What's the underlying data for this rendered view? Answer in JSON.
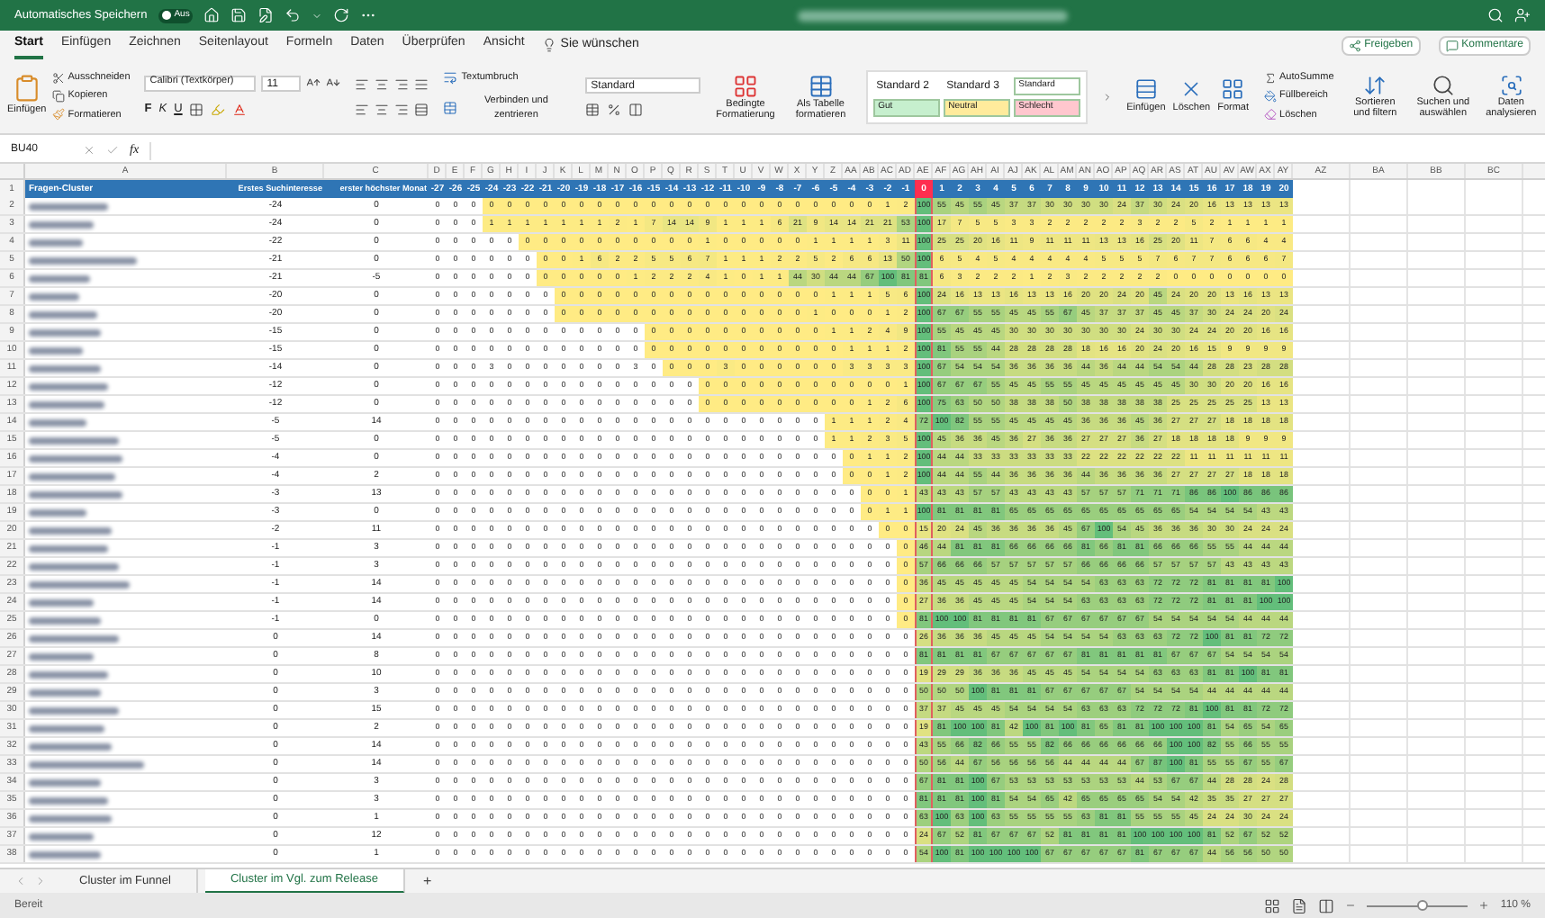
{
  "title_bar": {
    "autosave_label": "Automatisches Speichern",
    "autosave": {
      "on": false,
      "label": "Aus"
    }
  },
  "menu_tabs": [
    {
      "label": "Start",
      "selected": true
    },
    {
      "label": "Einfügen",
      "selected": false
    },
    {
      "label": "Zeichnen",
      "selected": false
    },
    {
      "label": "Seitenlayout",
      "selected": false
    },
    {
      "label": "Formeln",
      "selected": false
    },
    {
      "label": "Daten",
      "selected": false
    },
    {
      "label": "Überprüfen",
      "selected": false
    },
    {
      "label": "Ansicht",
      "selected": false
    }
  ],
  "tell_me": "Sie wünschen",
  "share": "Freigeben",
  "comments": "Kommentare",
  "clipboard": {
    "paste": "Einfügen",
    "cut": "Ausschneiden",
    "copy": "Kopieren",
    "format": "Formatieren"
  },
  "font": {
    "name": "Calibri (Textkörper)",
    "size": "11",
    "bold": "F",
    "italic": "K",
    "underline": "U"
  },
  "alignment": {
    "wrap": "Textumbruch",
    "merge": "Verbinden und zentrieren"
  },
  "number_format": "Standard",
  "conditional": "Bedingte Formatierung",
  "as_table": "Als Tabelle formatieren",
  "styles": [
    {
      "label": "Standard 2",
      "color": "#ffffff"
    },
    {
      "label": "Standard 3",
      "color": "#ffffff"
    },
    {
      "label": "Standard",
      "color": "#ffffff"
    },
    {
      "label": "Gut",
      "color": "#c6efce"
    },
    {
      "label": "Neutral",
      "color": "#ffeb9c"
    },
    {
      "label": "Schlecht",
      "color": "#ffc7ce"
    }
  ],
  "cells_group": [
    "Einfügen",
    "Löschen",
    "Format"
  ],
  "editing": {
    "autosum": "AutoSumme",
    "fill": "Füllbereich",
    "clear": "Löschen",
    "sort": "Sortieren und filtern",
    "find": "Suchen und auswählen",
    "analyze": "Daten analysieren"
  },
  "formula_bar": {
    "name_box": "BU40",
    "fx": "fx"
  },
  "column_letters": [
    "A",
    "B",
    "C",
    "D",
    "E",
    "F",
    "G",
    "H",
    "I",
    "J",
    "K",
    "L",
    "M",
    "N",
    "O",
    "P",
    "Q",
    "R",
    "S",
    "T",
    "U",
    "V",
    "W",
    "X",
    "Y",
    "Z",
    "AA",
    "AB",
    "AC",
    "AD",
    "AE",
    "AF",
    "AG",
    "AH",
    "AI",
    "AJ",
    "AK",
    "AL",
    "AM",
    "AN",
    "AO",
    "AP",
    "AQ",
    "AR",
    "AS",
    "AT",
    "AU",
    "AV",
    "AW",
    "AX",
    "AY",
    "AZ",
    "BA",
    "BB",
    "BC"
  ],
  "header_row": {
    "number": "1",
    "a": "Fragen-Cluster",
    "b": "Erstes Suchinteresse",
    "c": "erster höchster Monat",
    "cells": [
      "-27",
      "-26",
      "-25",
      "-24",
      "-23",
      "-22",
      "-21",
      "-20",
      "-19",
      "-18",
      "-17",
      "-16",
      "-15",
      "-14",
      "-13",
      "-12",
      "-11",
      "-10",
      "-9",
      "-8",
      "-7",
      "-6",
      "-5",
      "-4",
      "-3",
      "-2",
      "-1",
      "0",
      "1",
      "2",
      "3",
      "4",
      "5",
      "6",
      "7",
      "8",
      "9",
      "10",
      "11",
      "12",
      "13",
      "14",
      "15",
      "16",
      "17",
      "18",
      "19",
      "20"
    ]
  },
  "rows": [
    {
      "number": "2",
      "b": "-24",
      "c": "0",
      "cells": [
        "0",
        "0",
        "0",
        "0",
        "0",
        "0",
        "0",
        "0",
        "0",
        "0",
        "0",
        "0",
        "0",
        "0",
        "0",
        "0",
        "0",
        "0",
        "0",
        "0",
        "0",
        "0",
        "0",
        "0",
        "0",
        "1",
        "2",
        "100",
        "55",
        "45",
        "55",
        "45",
        "37",
        "37",
        "30",
        "30",
        "30",
        "30",
        "24",
        "37",
        "30",
        "24",
        "20",
        "16",
        "13",
        "13",
        "13",
        "13"
      ]
    },
    {
      "number": "3",
      "b": "-24",
      "c": "0",
      "cells": [
        "0",
        "0",
        "0",
        "1",
        "1",
        "1",
        "1",
        "1",
        "1",
        "1",
        "2",
        "1",
        "7",
        "14",
        "14",
        "9",
        "1",
        "1",
        "1",
        "6",
        "21",
        "9",
        "14",
        "14",
        "21",
        "21",
        "53",
        "100",
        "17",
        "7",
        "5",
        "5",
        "3",
        "3",
        "2",
        "2",
        "2",
        "2",
        "2",
        "3",
        "2",
        "2",
        "5",
        "2",
        "1",
        "1",
        "1",
        "1"
      ]
    },
    {
      "number": "4",
      "b": "-22",
      "c": "0",
      "cells": [
        "0",
        "0",
        "0",
        "0",
        "0",
        "0",
        "0",
        "0",
        "0",
        "0",
        "0",
        "0",
        "0",
        "0",
        "0",
        "1",
        "0",
        "0",
        "0",
        "0",
        "0",
        "1",
        "1",
        "1",
        "1",
        "3",
        "11",
        "100",
        "25",
        "25",
        "20",
        "16",
        "11",
        "9",
        "11",
        "11",
        "11",
        "13",
        "13",
        "16",
        "25",
        "20",
        "11",
        "7",
        "6",
        "6",
        "4",
        "4"
      ]
    },
    {
      "number": "5",
      "b": "-21",
      "c": "0",
      "cells": [
        "0",
        "0",
        "0",
        "0",
        "0",
        "0",
        "0",
        "0",
        "1",
        "6",
        "2",
        "2",
        "5",
        "5",
        "6",
        "7",
        "1",
        "1",
        "1",
        "2",
        "2",
        "5",
        "2",
        "6",
        "6",
        "13",
        "50",
        "100",
        "6",
        "5",
        "4",
        "5",
        "4",
        "4",
        "4",
        "4",
        "4",
        "5",
        "5",
        "5",
        "7",
        "6",
        "7",
        "7",
        "6",
        "6",
        "6",
        "7"
      ]
    },
    {
      "number": "6",
      "b": "-21",
      "c": "-5",
      "cells": [
        "0",
        "0",
        "0",
        "0",
        "0",
        "0",
        "0",
        "0",
        "0",
        "0",
        "0",
        "1",
        "2",
        "2",
        "2",
        "4",
        "1",
        "0",
        "1",
        "1",
        "44",
        "30",
        "44",
        "44",
        "67",
        "100",
        "81",
        "81",
        "6",
        "3",
        "2",
        "2",
        "2",
        "1",
        "2",
        "3",
        "2",
        "2",
        "2",
        "2",
        "2",
        "0",
        "0",
        "0",
        "0",
        "0",
        "0",
        "0"
      ]
    },
    {
      "number": "7",
      "b": "-20",
      "c": "0",
      "cells": [
        "0",
        "0",
        "0",
        "0",
        "0",
        "0",
        "0",
        "0",
        "0",
        "0",
        "0",
        "0",
        "0",
        "0",
        "0",
        "0",
        "0",
        "0",
        "0",
        "0",
        "0",
        "0",
        "1",
        "1",
        "1",
        "5",
        "6",
        "100",
        "24",
        "16",
        "13",
        "13",
        "16",
        "13",
        "13",
        "16",
        "20",
        "20",
        "24",
        "20",
        "45",
        "24",
        "20",
        "20",
        "13",
        "16",
        "13",
        "13"
      ]
    },
    {
      "number": "8",
      "b": "-20",
      "c": "0",
      "cells": [
        "0",
        "0",
        "0",
        "0",
        "0",
        "0",
        "0",
        "0",
        "0",
        "0",
        "0",
        "0",
        "0",
        "0",
        "0",
        "0",
        "0",
        "0",
        "0",
        "0",
        "0",
        "1",
        "0",
        "0",
        "0",
        "1",
        "2",
        "100",
        "67",
        "67",
        "55",
        "55",
        "45",
        "45",
        "55",
        "67",
        "45",
        "37",
        "37",
        "37",
        "45",
        "45",
        "37",
        "30",
        "24",
        "24",
        "20",
        "24"
      ]
    },
    {
      "number": "9",
      "b": "-15",
      "c": "0",
      "cells": [
        "0",
        "0",
        "0",
        "0",
        "0",
        "0",
        "0",
        "0",
        "0",
        "0",
        "0",
        "0",
        "0",
        "0",
        "0",
        "0",
        "0",
        "0",
        "0",
        "0",
        "0",
        "0",
        "1",
        "1",
        "2",
        "4",
        "9",
        "100",
        "55",
        "45",
        "45",
        "45",
        "30",
        "30",
        "30",
        "30",
        "30",
        "30",
        "30",
        "24",
        "30",
        "30",
        "24",
        "24",
        "20",
        "20",
        "16",
        "16"
      ]
    },
    {
      "number": "10",
      "b": "-15",
      "c": "0",
      "cells": [
        "0",
        "0",
        "0",
        "0",
        "0",
        "0",
        "0",
        "0",
        "0",
        "0",
        "0",
        "0",
        "0",
        "0",
        "0",
        "0",
        "0",
        "0",
        "0",
        "0",
        "0",
        "0",
        "0",
        "1",
        "1",
        "1",
        "2",
        "100",
        "81",
        "55",
        "55",
        "44",
        "28",
        "28",
        "28",
        "28",
        "18",
        "16",
        "16",
        "20",
        "24",
        "20",
        "16",
        "15",
        "9",
        "9",
        "9",
        "9"
      ]
    },
    {
      "number": "11",
      "b": "-14",
      "c": "0",
      "cells": [
        "0",
        "0",
        "0",
        "3",
        "0",
        "0",
        "0",
        "0",
        "0",
        "0",
        "0",
        "3",
        "0",
        "0",
        "0",
        "0",
        "3",
        "0",
        "0",
        "0",
        "0",
        "0",
        "0",
        "3",
        "3",
        "3",
        "3",
        "100",
        "67",
        "54",
        "54",
        "54",
        "36",
        "36",
        "36",
        "36",
        "44",
        "36",
        "44",
        "44",
        "54",
        "54",
        "44",
        "28",
        "28",
        "23",
        "28",
        "28"
      ]
    },
    {
      "number": "12",
      "b": "-12",
      "c": "0",
      "cells": [
        "0",
        "0",
        "0",
        "0",
        "0",
        "0",
        "0",
        "0",
        "0",
        "0",
        "0",
        "0",
        "0",
        "0",
        "0",
        "0",
        "0",
        "0",
        "0",
        "0",
        "0",
        "0",
        "0",
        "0",
        "0",
        "0",
        "1",
        "100",
        "67",
        "67",
        "67",
        "55",
        "45",
        "45",
        "55",
        "55",
        "45",
        "45",
        "45",
        "45",
        "45",
        "45",
        "30",
        "30",
        "20",
        "20",
        "16",
        "16"
      ]
    },
    {
      "number": "13",
      "b": "-12",
      "c": "0",
      "cells": [
        "0",
        "0",
        "0",
        "0",
        "0",
        "0",
        "0",
        "0",
        "0",
        "0",
        "0",
        "0",
        "0",
        "0",
        "0",
        "0",
        "0",
        "0",
        "0",
        "0",
        "0",
        "0",
        "0",
        "0",
        "1",
        "2",
        "6",
        "100",
        "75",
        "63",
        "50",
        "50",
        "38",
        "38",
        "38",
        "50",
        "38",
        "38",
        "38",
        "38",
        "38",
        "25",
        "25",
        "25",
        "25",
        "25",
        "13",
        "13"
      ]
    },
    {
      "number": "14",
      "b": "-5",
      "c": "14",
      "cells": [
        "0",
        "0",
        "0",
        "0",
        "0",
        "0",
        "0",
        "0",
        "0",
        "0",
        "0",
        "0",
        "0",
        "0",
        "0",
        "0",
        "0",
        "0",
        "0",
        "0",
        "0",
        "0",
        "1",
        "1",
        "1",
        "2",
        "4",
        "72",
        "100",
        "82",
        "55",
        "55",
        "45",
        "45",
        "45",
        "45",
        "36",
        "36",
        "36",
        "45",
        "36",
        "27",
        "27",
        "27",
        "18",
        "18",
        "18",
        "18"
      ]
    },
    {
      "number": "15",
      "b": "-5",
      "c": "0",
      "cells": [
        "0",
        "0",
        "0",
        "0",
        "0",
        "0",
        "0",
        "0",
        "0",
        "0",
        "0",
        "0",
        "0",
        "0",
        "0",
        "0",
        "0",
        "0",
        "0",
        "0",
        "0",
        "0",
        "1",
        "1",
        "2",
        "3",
        "5",
        "100",
        "45",
        "36",
        "36",
        "45",
        "36",
        "27",
        "36",
        "36",
        "27",
        "27",
        "27",
        "36",
        "27",
        "18",
        "18",
        "18",
        "18",
        "9",
        "9",
        "9"
      ]
    },
    {
      "number": "16",
      "b": "-4",
      "c": "0",
      "cells": [
        "0",
        "0",
        "0",
        "0",
        "0",
        "0",
        "0",
        "0",
        "0",
        "0",
        "0",
        "0",
        "0",
        "0",
        "0",
        "0",
        "0",
        "0",
        "0",
        "0",
        "0",
        "0",
        "0",
        "0",
        "1",
        "1",
        "2",
        "100",
        "44",
        "44",
        "33",
        "33",
        "33",
        "33",
        "33",
        "33",
        "22",
        "22",
        "22",
        "22",
        "22",
        "22",
        "11",
        "11",
        "11",
        "11",
        "11",
        "11"
      ]
    },
    {
      "number": "17",
      "b": "-4",
      "c": "2",
      "cells": [
        "0",
        "0",
        "0",
        "0",
        "0",
        "0",
        "0",
        "0",
        "0",
        "0",
        "0",
        "0",
        "0",
        "0",
        "0",
        "0",
        "0",
        "0",
        "0",
        "0",
        "0",
        "0",
        "0",
        "0",
        "0",
        "1",
        "2",
        "100",
        "44",
        "44",
        "55",
        "44",
        "36",
        "36",
        "36",
        "36",
        "44",
        "36",
        "36",
        "36",
        "36",
        "27",
        "27",
        "27",
        "27",
        "18",
        "18",
        "18"
      ]
    },
    {
      "number": "18",
      "b": "-3",
      "c": "13",
      "cells": [
        "0",
        "0",
        "0",
        "0",
        "0",
        "0",
        "0",
        "0",
        "0",
        "0",
        "0",
        "0",
        "0",
        "0",
        "0",
        "0",
        "0",
        "0",
        "0",
        "0",
        "0",
        "0",
        "0",
        "0",
        "0",
        "0",
        "1",
        "43",
        "43",
        "43",
        "57",
        "57",
        "43",
        "43",
        "43",
        "43",
        "57",
        "57",
        "57",
        "71",
        "71",
        "71",
        "86",
        "86",
        "100",
        "86",
        "86",
        "86"
      ]
    },
    {
      "number": "19",
      "b": "-3",
      "c": "0",
      "cells": [
        "0",
        "0",
        "0",
        "0",
        "0",
        "0",
        "0",
        "0",
        "0",
        "0",
        "0",
        "0",
        "0",
        "0",
        "0",
        "0",
        "0",
        "0",
        "0",
        "0",
        "0",
        "0",
        "0",
        "0",
        "0",
        "1",
        "1",
        "100",
        "81",
        "81",
        "81",
        "81",
        "65",
        "65",
        "65",
        "65",
        "65",
        "65",
        "65",
        "65",
        "65",
        "65",
        "54",
        "54",
        "54",
        "54",
        "43",
        "43"
      ]
    },
    {
      "number": "20",
      "b": "-2",
      "c": "11",
      "cells": [
        "0",
        "0",
        "0",
        "0",
        "0",
        "0",
        "0",
        "0",
        "0",
        "0",
        "0",
        "0",
        "0",
        "0",
        "0",
        "0",
        "0",
        "0",
        "0",
        "0",
        "0",
        "0",
        "0",
        "0",
        "0",
        "0",
        "0",
        "15",
        "20",
        "24",
        "45",
        "36",
        "36",
        "36",
        "36",
        "45",
        "67",
        "100",
        "54",
        "45",
        "36",
        "36",
        "36",
        "30",
        "30",
        "24",
        "24",
        "24"
      ]
    },
    {
      "number": "21",
      "b": "-1",
      "c": "3",
      "cells": [
        "0",
        "0",
        "0",
        "0",
        "0",
        "0",
        "0",
        "0",
        "0",
        "0",
        "0",
        "0",
        "0",
        "0",
        "0",
        "0",
        "0",
        "0",
        "0",
        "0",
        "0",
        "0",
        "0",
        "0",
        "0",
        "0",
        "0",
        "46",
        "44",
        "81",
        "81",
        "81",
        "66",
        "66",
        "66",
        "66",
        "81",
        "66",
        "81",
        "81",
        "66",
        "66",
        "66",
        "55",
        "55",
        "44",
        "44",
        "44"
      ]
    },
    {
      "number": "22",
      "b": "-1",
      "c": "3",
      "cells": [
        "0",
        "0",
        "0",
        "0",
        "0",
        "0",
        "0",
        "0",
        "0",
        "0",
        "0",
        "0",
        "0",
        "0",
        "0",
        "0",
        "0",
        "0",
        "0",
        "0",
        "0",
        "0",
        "0",
        "0",
        "0",
        "0",
        "0",
        "57",
        "66",
        "66",
        "66",
        "57",
        "57",
        "57",
        "57",
        "57",
        "66",
        "66",
        "66",
        "66",
        "57",
        "57",
        "57",
        "57",
        "43",
        "43",
        "43",
        "43"
      ]
    },
    {
      "number": "23",
      "b": "-1",
      "c": "14",
      "cells": [
        "0",
        "0",
        "0",
        "0",
        "0",
        "0",
        "0",
        "0",
        "0",
        "0",
        "0",
        "0",
        "0",
        "0",
        "0",
        "0",
        "0",
        "0",
        "0",
        "0",
        "0",
        "0",
        "0",
        "0",
        "0",
        "0",
        "0",
        "36",
        "45",
        "45",
        "45",
        "45",
        "45",
        "54",
        "54",
        "54",
        "54",
        "63",
        "63",
        "63",
        "72",
        "72",
        "72",
        "81",
        "81",
        "81",
        "81",
        "100"
      ]
    },
    {
      "number": "24",
      "b": "-1",
      "c": "14",
      "cells": [
        "0",
        "0",
        "0",
        "0",
        "0",
        "0",
        "0",
        "0",
        "0",
        "0",
        "0",
        "0",
        "0",
        "0",
        "0",
        "0",
        "0",
        "0",
        "0",
        "0",
        "0",
        "0",
        "0",
        "0",
        "0",
        "0",
        "0",
        "27",
        "36",
        "36",
        "45",
        "45",
        "45",
        "54",
        "54",
        "54",
        "63",
        "63",
        "63",
        "63",
        "72",
        "72",
        "72",
        "81",
        "81",
        "81",
        "100",
        "100"
      ]
    },
    {
      "number": "25",
      "b": "-1",
      "c": "0",
      "cells": [
        "0",
        "0",
        "0",
        "0",
        "0",
        "0",
        "0",
        "0",
        "0",
        "0",
        "0",
        "0",
        "0",
        "0",
        "0",
        "0",
        "0",
        "0",
        "0",
        "0",
        "0",
        "0",
        "0",
        "0",
        "0",
        "0",
        "0",
        "81",
        "100",
        "100",
        "81",
        "81",
        "81",
        "81",
        "67",
        "67",
        "67",
        "67",
        "67",
        "67",
        "54",
        "54",
        "54",
        "54",
        "54",
        "44",
        "44",
        "44"
      ]
    },
    {
      "number": "26",
      "b": "0",
      "c": "14",
      "cells": [
        "0",
        "0",
        "0",
        "0",
        "0",
        "0",
        "0",
        "0",
        "0",
        "0",
        "0",
        "0",
        "0",
        "0",
        "0",
        "0",
        "0",
        "0",
        "0",
        "0",
        "0",
        "0",
        "0",
        "0",
        "0",
        "0",
        "0",
        "26",
        "36",
        "36",
        "36",
        "45",
        "45",
        "45",
        "54",
        "54",
        "54",
        "54",
        "63",
        "63",
        "63",
        "72",
        "72",
        "100",
        "81",
        "81",
        "72",
        "72"
      ]
    },
    {
      "number": "27",
      "b": "0",
      "c": "8",
      "cells": [
        "0",
        "0",
        "0",
        "0",
        "0",
        "0",
        "0",
        "0",
        "0",
        "0",
        "0",
        "0",
        "0",
        "0",
        "0",
        "0",
        "0",
        "0",
        "0",
        "0",
        "0",
        "0",
        "0",
        "0",
        "0",
        "0",
        "0",
        "81",
        "81",
        "81",
        "81",
        "67",
        "67",
        "67",
        "67",
        "67",
        "81",
        "81",
        "81",
        "81",
        "81",
        "67",
        "67",
        "67",
        "54",
        "54",
        "54",
        "54"
      ]
    },
    {
      "number": "28",
      "b": "0",
      "c": "10",
      "cells": [
        "0",
        "0",
        "0",
        "0",
        "0",
        "0",
        "0",
        "0",
        "0",
        "0",
        "0",
        "0",
        "0",
        "0",
        "0",
        "0",
        "0",
        "0",
        "0",
        "0",
        "0",
        "0",
        "0",
        "0",
        "0",
        "0",
        "0",
        "19",
        "29",
        "29",
        "36",
        "36",
        "36",
        "45",
        "45",
        "45",
        "54",
        "54",
        "54",
        "54",
        "63",
        "63",
        "63",
        "81",
        "81",
        "100",
        "81",
        "81"
      ]
    },
    {
      "number": "29",
      "b": "0",
      "c": "3",
      "cells": [
        "0",
        "0",
        "0",
        "0",
        "0",
        "0",
        "0",
        "0",
        "0",
        "0",
        "0",
        "0",
        "0",
        "0",
        "0",
        "0",
        "0",
        "0",
        "0",
        "0",
        "0",
        "0",
        "0",
        "0",
        "0",
        "0",
        "0",
        "50",
        "50",
        "50",
        "100",
        "81",
        "81",
        "81",
        "67",
        "67",
        "67",
        "67",
        "67",
        "54",
        "54",
        "54",
        "54",
        "44",
        "44",
        "44",
        "44",
        "44"
      ]
    },
    {
      "number": "30",
      "b": "0",
      "c": "15",
      "cells": [
        "0",
        "0",
        "0",
        "0",
        "0",
        "0",
        "0",
        "0",
        "0",
        "0",
        "0",
        "0",
        "0",
        "0",
        "0",
        "0",
        "0",
        "0",
        "0",
        "0",
        "0",
        "0",
        "0",
        "0",
        "0",
        "0",
        "0",
        "37",
        "37",
        "45",
        "45",
        "45",
        "54",
        "54",
        "54",
        "54",
        "63",
        "63",
        "63",
        "72",
        "72",
        "72",
        "81",
        "100",
        "81",
        "81",
        "72",
        "72"
      ]
    },
    {
      "number": "31",
      "b": "0",
      "c": "2",
      "cells": [
        "0",
        "0",
        "0",
        "0",
        "0",
        "0",
        "0",
        "0",
        "0",
        "0",
        "0",
        "0",
        "0",
        "0",
        "0",
        "0",
        "0",
        "0",
        "0",
        "0",
        "0",
        "0",
        "0",
        "0",
        "0",
        "0",
        "0",
        "19",
        "81",
        "100",
        "100",
        "81",
        "42",
        "100",
        "81",
        "100",
        "81",
        "65",
        "81",
        "81",
        "100",
        "100",
        "100",
        "81",
        "54",
        "65",
        "54",
        "65"
      ]
    },
    {
      "number": "32",
      "b": "0",
      "c": "14",
      "cells": [
        "0",
        "0",
        "0",
        "0",
        "0",
        "0",
        "0",
        "0",
        "0",
        "0",
        "0",
        "0",
        "0",
        "0",
        "0",
        "0",
        "0",
        "0",
        "0",
        "0",
        "0",
        "0",
        "0",
        "0",
        "0",
        "0",
        "0",
        "43",
        "55",
        "66",
        "82",
        "66",
        "55",
        "55",
        "82",
        "66",
        "66",
        "66",
        "66",
        "66",
        "66",
        "100",
        "100",
        "82",
        "55",
        "66",
        "55",
        "55"
      ]
    },
    {
      "number": "33",
      "b": "0",
      "c": "14",
      "cells": [
        "0",
        "0",
        "0",
        "0",
        "0",
        "0",
        "0",
        "0",
        "0",
        "0",
        "0",
        "0",
        "0",
        "0",
        "0",
        "0",
        "0",
        "0",
        "0",
        "0",
        "0",
        "0",
        "0",
        "0",
        "0",
        "0",
        "0",
        "50",
        "56",
        "44",
        "67",
        "56",
        "56",
        "56",
        "56",
        "44",
        "44",
        "44",
        "44",
        "67",
        "87",
        "100",
        "81",
        "55",
        "55",
        "67",
        "55",
        "67"
      ]
    },
    {
      "number": "34",
      "b": "0",
      "c": "3",
      "cells": [
        "0",
        "0",
        "0",
        "0",
        "0",
        "0",
        "0",
        "0",
        "0",
        "0",
        "0",
        "0",
        "0",
        "0",
        "0",
        "0",
        "0",
        "0",
        "0",
        "0",
        "0",
        "0",
        "0",
        "0",
        "0",
        "0",
        "0",
        "67",
        "81",
        "81",
        "100",
        "67",
        "53",
        "53",
        "53",
        "53",
        "53",
        "53",
        "53",
        "44",
        "53",
        "67",
        "67",
        "44",
        "28",
        "28",
        "24",
        "28"
      ]
    },
    {
      "number": "35",
      "b": "0",
      "c": "3",
      "cells": [
        "0",
        "0",
        "0",
        "0",
        "0",
        "0",
        "0",
        "0",
        "0",
        "0",
        "0",
        "0",
        "0",
        "0",
        "0",
        "0",
        "0",
        "0",
        "0",
        "0",
        "0",
        "0",
        "0",
        "0",
        "0",
        "0",
        "0",
        "81",
        "81",
        "81",
        "100",
        "81",
        "54",
        "54",
        "65",
        "42",
        "65",
        "65",
        "65",
        "65",
        "54",
        "54",
        "42",
        "35",
        "35",
        "27",
        "27",
        "27"
      ]
    },
    {
      "number": "36",
      "b": "0",
      "c": "1",
      "cells": [
        "0",
        "0",
        "0",
        "0",
        "0",
        "0",
        "0",
        "0",
        "0",
        "0",
        "0",
        "0",
        "0",
        "0",
        "0",
        "0",
        "0",
        "0",
        "0",
        "0",
        "0",
        "0",
        "0",
        "0",
        "0",
        "0",
        "0",
        "63",
        "100",
        "63",
        "100",
        "63",
        "55",
        "55",
        "55",
        "55",
        "63",
        "81",
        "81",
        "55",
        "55",
        "55",
        "45",
        "24",
        "24",
        "30",
        "24",
        "24"
      ]
    },
    {
      "number": "37",
      "b": "0",
      "c": "12",
      "cells": [
        "0",
        "0",
        "0",
        "0",
        "0",
        "0",
        "0",
        "0",
        "0",
        "0",
        "0",
        "0",
        "0",
        "0",
        "0",
        "0",
        "0",
        "0",
        "0",
        "0",
        "0",
        "0",
        "0",
        "0",
        "0",
        "0",
        "0",
        "24",
        "67",
        "52",
        "81",
        "67",
        "67",
        "67",
        "52",
        "81",
        "81",
        "81",
        "81",
        "100",
        "100",
        "100",
        "100",
        "81",
        "52",
        "67",
        "52",
        "52"
      ]
    },
    {
      "number": "38",
      "b": "0",
      "c": "1",
      "cells": [
        "0",
        "0",
        "0",
        "0",
        "0",
        "0",
        "0",
        "0",
        "0",
        "0",
        "0",
        "0",
        "0",
        "0",
        "0",
        "0",
        "0",
        "0",
        "0",
        "0",
        "0",
        "0",
        "0",
        "0",
        "0",
        "0",
        "0",
        "54",
        "100",
        "81",
        "100",
        "100",
        "100",
        "100",
        "67",
        "67",
        "67",
        "67",
        "67",
        "81",
        "67",
        "67",
        "67",
        "44",
        "56",
        "56",
        "50",
        "50"
      ]
    }
  ],
  "sheet_tabs": [
    {
      "label": "Cluster im Funnel",
      "selected": false
    },
    {
      "label": "Cluster im Vgl. zum Release",
      "selected": true
    }
  ],
  "add_sheet": "+",
  "status_bar": {
    "status": "Bereit",
    "zoom": "110 %",
    "zoom_slider": {
      "level": 0.55
    }
  }
}
